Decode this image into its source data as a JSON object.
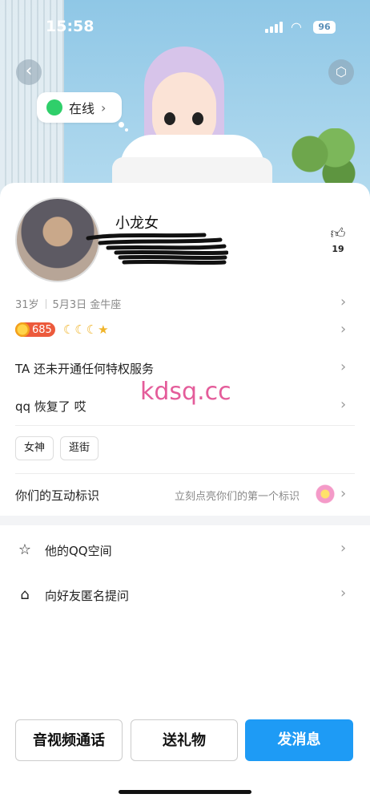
{
  "status_bar": {
    "time": "15:58",
    "battery": "96"
  },
  "header": {
    "online_label": "在线",
    "back_icon": "back-arrow-icon",
    "cube_icon": "cube-icon"
  },
  "profile": {
    "name": "小龙女",
    "likes": "19",
    "age": "31岁",
    "birthday": "5月3日",
    "zodiac": "金牛座",
    "level": "685",
    "privilege_text": "TA 还未开通任何特权服务",
    "signature": "qq 恢复了  哎",
    "tags": [
      "女神",
      "逛街"
    ]
  },
  "interaction": {
    "label": "你们的互动标识",
    "hint": "立刻点亮你们的第一个标识"
  },
  "list": [
    {
      "label": "他的QQ空间",
      "icon": "star-icon"
    },
    {
      "label": "向好友匿名提问",
      "icon": "cat-icon"
    }
  ],
  "watermark": "kdsq.cc",
  "actions": {
    "call": "音视频通话",
    "gift": "送礼物",
    "message": "发消息"
  },
  "colors": {
    "primary": "#1e9bf5",
    "online": "#2fcf6a",
    "level": "#ec5a3c",
    "watermark": "#e45c9a"
  }
}
